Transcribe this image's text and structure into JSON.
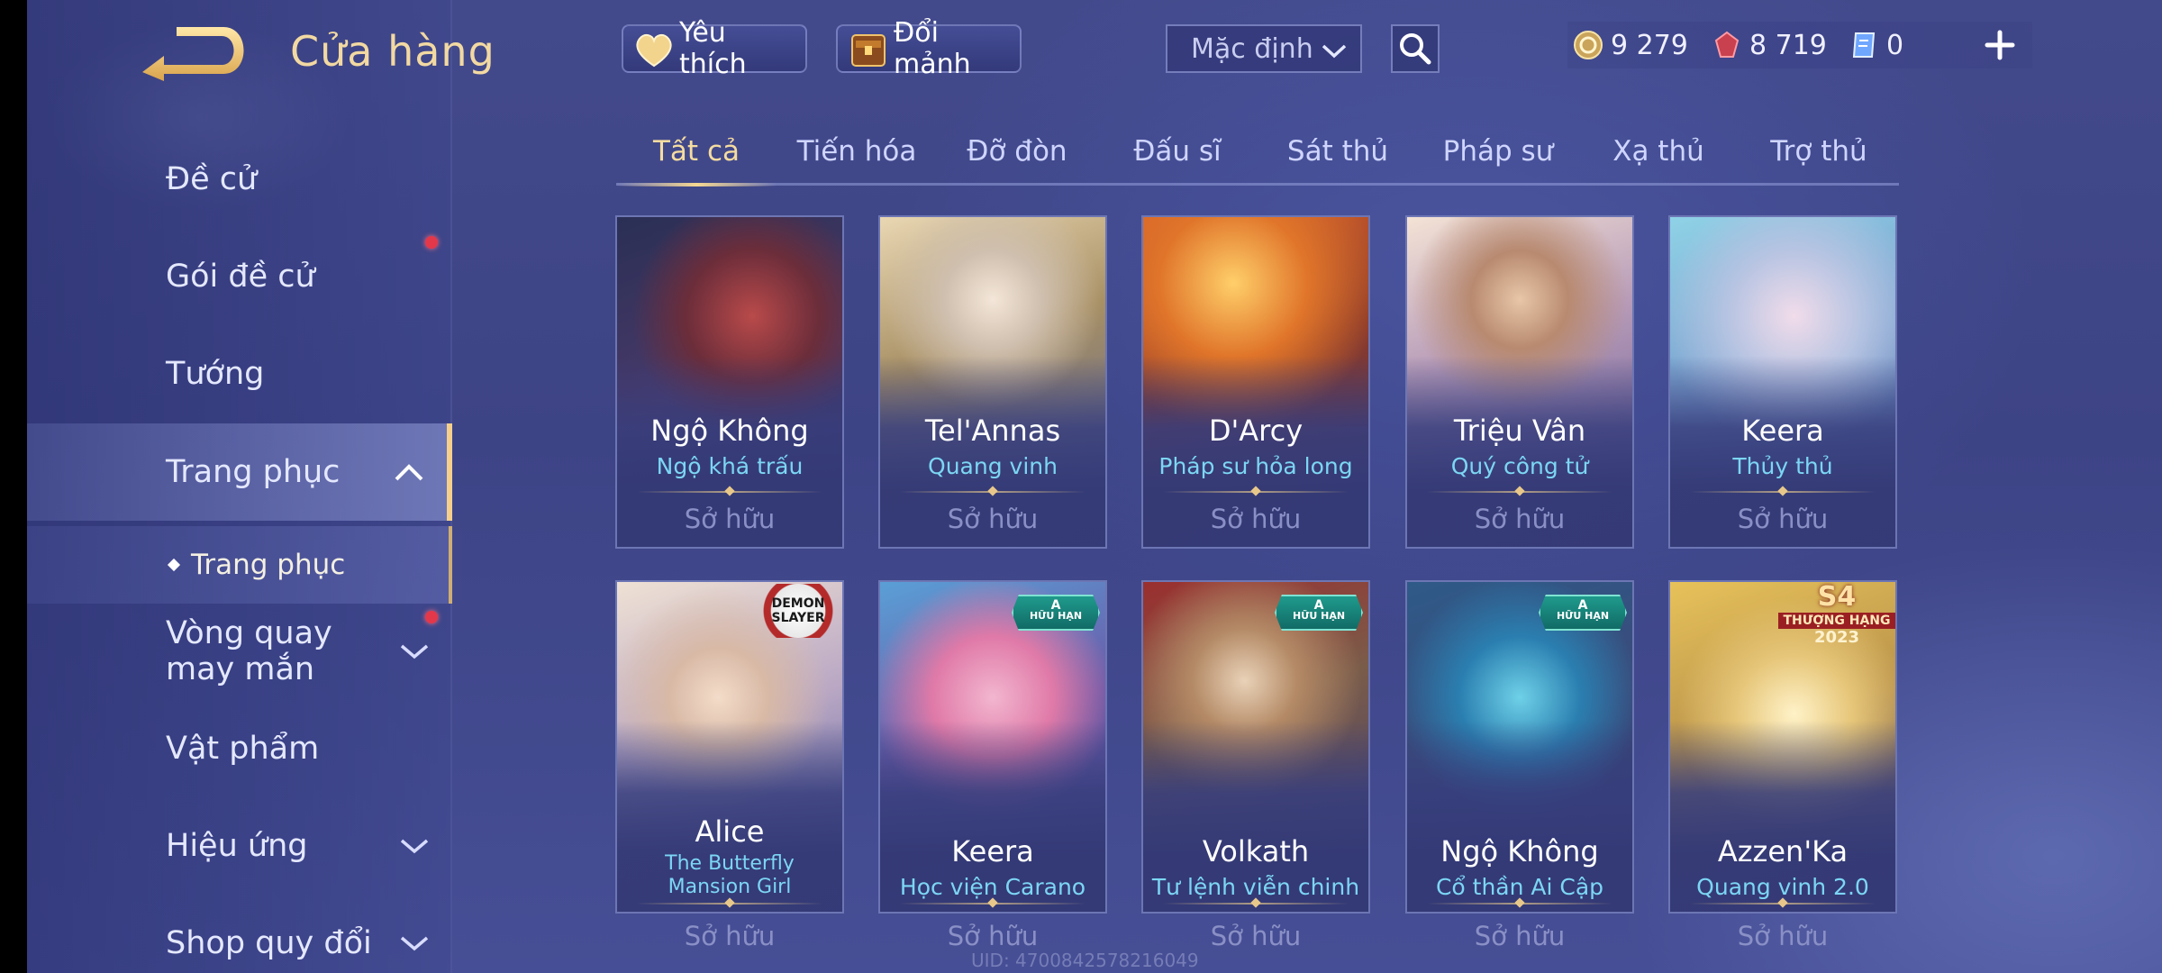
{
  "header": {
    "title": "Cửa hàng",
    "favorites_label": "Yêu thích",
    "exchange_label": "Đổi mảnh",
    "sort_selected": "Mặc định"
  },
  "currencies": [
    {
      "icon": "gold-coin-icon",
      "value": "9 279"
    },
    {
      "icon": "red-gem-icon",
      "value": "8 719"
    },
    {
      "icon": "voucher-icon",
      "value": "0"
    }
  ],
  "sidebar": {
    "items": [
      {
        "label": "Đề cử"
      },
      {
        "label": "Gói đề cử"
      },
      {
        "label": "Tướng"
      },
      {
        "label": "Trang phục"
      },
      {
        "label": "Vòng quay may mắn"
      },
      {
        "label": "Vật phẩm"
      },
      {
        "label": "Hiệu ứng"
      },
      {
        "label": "Shop quy đổi"
      }
    ],
    "sub_item": "Trang phục"
  },
  "tabs": [
    "Tất cả",
    "Tiến hóa",
    "Đỡ đòn",
    "Đấu sĩ",
    "Sát thủ",
    "Pháp sư",
    "Xạ thủ",
    "Trợ thủ"
  ],
  "cards": [
    {
      "hero": "Ngộ Không",
      "skin": "Ngộ khá trấu",
      "status": "Sở hữu"
    },
    {
      "hero": "Tel'Annas",
      "skin": "Quang vinh",
      "status": "Sở hữu"
    },
    {
      "hero": "D'Arcy",
      "skin": "Pháp sư hỏa long",
      "status": "Sở hữu"
    },
    {
      "hero": "Triệu Vân",
      "skin": "Quý công tử",
      "status": "Sở hữu"
    },
    {
      "hero": "Keera",
      "skin": "Thủy thủ",
      "status": "Sở hữu"
    },
    {
      "hero": "Alice",
      "skin": "The Butterfly Mansion Girl",
      "status": "Sở hữu",
      "corner": "DEMON SLAYER"
    },
    {
      "hero": "Keera",
      "skin": "Học viện Carano",
      "status": "Sở hữu",
      "badge": "A",
      "badge_text": "HỮU HẠN"
    },
    {
      "hero": "Volkath",
      "skin": "Tư lệnh viễn chinh",
      "status": "Sở hữu",
      "badge": "A",
      "badge_text": "HỮU HẠN"
    },
    {
      "hero": "Ngộ Không",
      "skin": "Cổ thần Ai Cập",
      "status": "Sở hữu",
      "badge": "A",
      "badge_text": "HỮU HẠN"
    },
    {
      "hero": "Azzen'Ka",
      "skin": "Quang vinh 2.0",
      "status": "Sở hữu",
      "corner": "S4",
      "corner_text": "THƯỢNG HẠNG",
      "corner_year": "2023"
    }
  ],
  "footer": {
    "uid": "UID: 4700842578216049"
  },
  "colors": {
    "accent_gold": "#f5dca0",
    "skin_name_blue": "#7cd6f4",
    "notification_red": "#e3374a",
    "badge_teal": "#1f9a8c"
  }
}
